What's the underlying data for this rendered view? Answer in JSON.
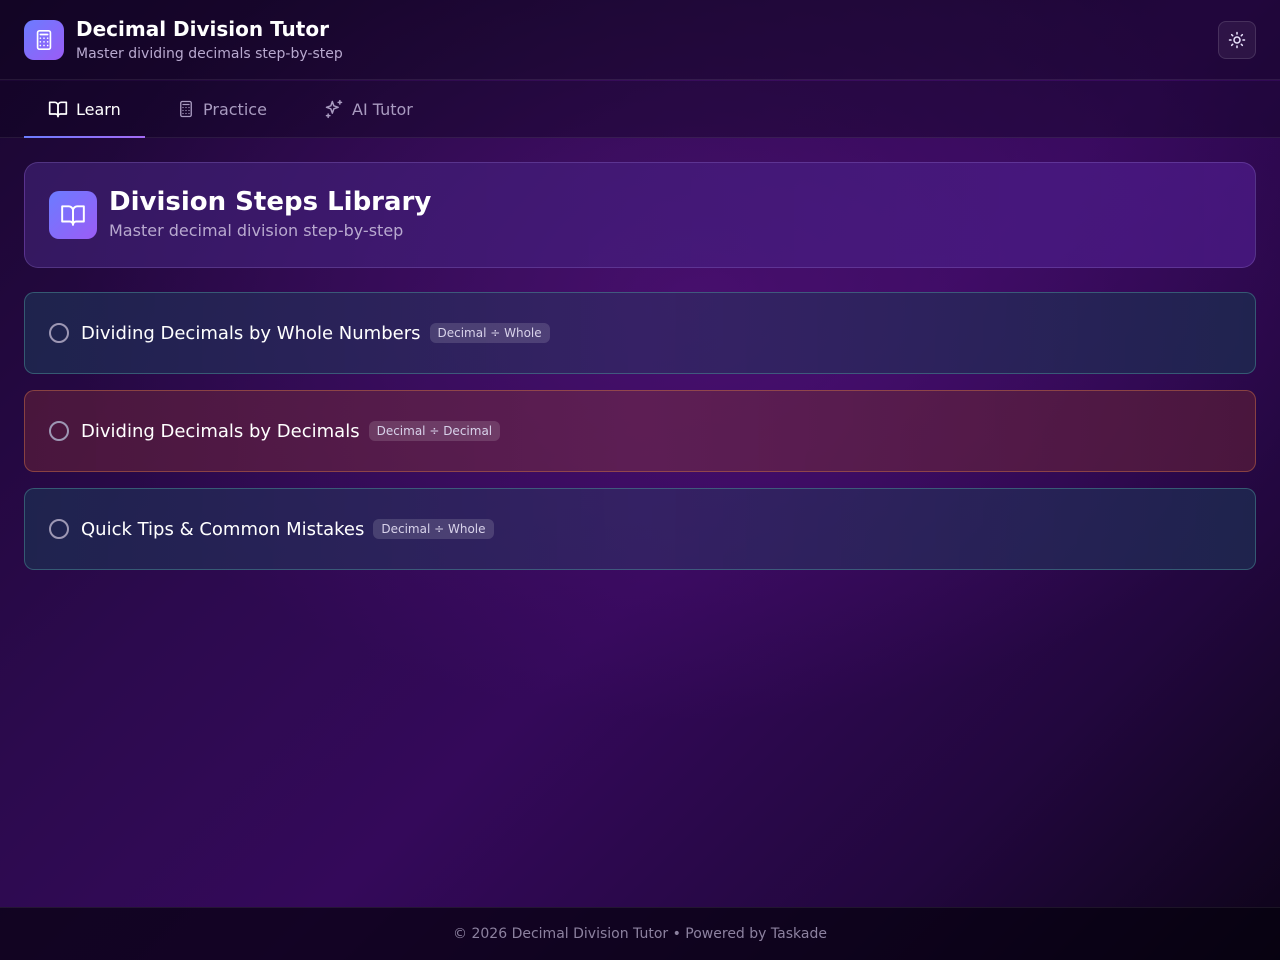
{
  "header": {
    "title": "Decimal Division Tutor",
    "subtitle": "Master dividing decimals step-by-step",
    "logo_icon": "calculator-icon",
    "theme_icon": "sun-icon"
  },
  "tabs": [
    {
      "label": "Learn",
      "icon": "book-open-icon",
      "active": true
    },
    {
      "label": "Practice",
      "icon": "calculator-icon",
      "active": false
    },
    {
      "label": "AI Tutor",
      "icon": "sparkles-icon",
      "active": false
    }
  ],
  "hero": {
    "title": "Division Steps Library",
    "subtitle": "Master decimal division step-by-step",
    "icon": "book-open-icon"
  },
  "topics": [
    {
      "title": "Dividing Decimals by Whole Numbers",
      "badge": "Decimal ÷ Whole",
      "accent": "#4fa0a0"
    },
    {
      "title": "Dividing Decimals by Decimals",
      "badge": "Decimal ÷ Decimal",
      "accent": "#c86e46"
    },
    {
      "title": "Quick Tips & Common Mistakes",
      "badge": "Decimal ÷ Whole",
      "accent": "#4fa0a0"
    }
  ],
  "footer": {
    "text": "© 2026 Decimal Division Tutor • Powered by Taskade"
  },
  "colors": {
    "accent_start": "#6b7cff",
    "accent_end": "#9b5cf6",
    "background": "#2c0a4e"
  }
}
